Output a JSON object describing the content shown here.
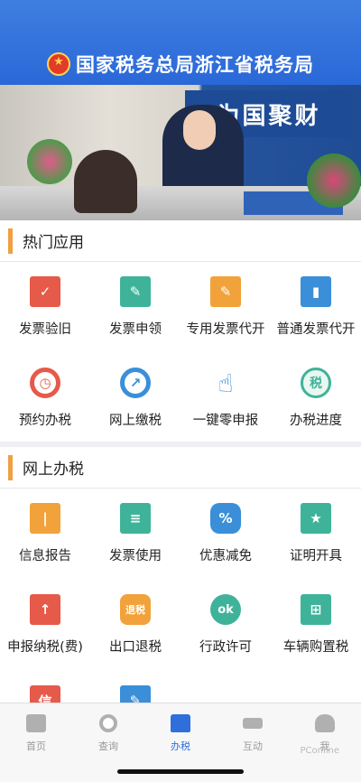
{
  "header": {
    "title": "国家税务总局浙江省税务局",
    "emblem_icon": "tax-emblem-icon"
  },
  "banner": {
    "sign_text": "为国聚财"
  },
  "hot_apps": {
    "title": "热门应用",
    "items": [
      {
        "label": "发票验旧",
        "icon": "invoice-check-icon",
        "glyph": "✓"
      },
      {
        "label": "发票申领",
        "icon": "pen-icon",
        "glyph": "✎"
      },
      {
        "label": "专用发票代开",
        "icon": "edit-icon",
        "glyph": "✎"
      },
      {
        "label": "普通发票代开",
        "icon": "document-icon",
        "glyph": "▮"
      },
      {
        "label": "预约办税",
        "icon": "clock-icon",
        "glyph": "◷"
      },
      {
        "label": "网上缴税",
        "icon": "compass-icon",
        "glyph": "↗"
      },
      {
        "label": "一键零申报",
        "icon": "tap-hand-icon",
        "glyph": "☝"
      },
      {
        "label": "办税进度",
        "icon": "tax-progress-icon",
        "glyph": "税"
      }
    ]
  },
  "online_tax": {
    "title": "网上办税",
    "items": [
      {
        "label": "信息报告",
        "icon": "info-report-icon",
        "glyph": "|"
      },
      {
        "label": "发票使用",
        "icon": "invoice-use-icon",
        "glyph": "≡"
      },
      {
        "label": "优惠减免",
        "icon": "discount-ticket-icon",
        "glyph": "%"
      },
      {
        "label": "证明开具",
        "icon": "certificate-icon",
        "glyph": "★"
      },
      {
        "label": "申报纳税(费)",
        "icon": "declare-icon",
        "glyph": "↑"
      },
      {
        "label": "出口退税",
        "icon": "tax-refund-icon",
        "glyph": "退税"
      },
      {
        "label": "行政许可",
        "icon": "ok-icon",
        "glyph": "ok"
      },
      {
        "label": "车辆购置税",
        "icon": "vehicle-tax-icon",
        "glyph": "⊞"
      },
      {
        "label": "",
        "icon": "credit-icon",
        "glyph": "信"
      },
      {
        "label": "",
        "icon": "form-edit-icon",
        "glyph": "✎"
      }
    ]
  },
  "tabbar": {
    "items": [
      {
        "label": "首页",
        "icon": "home-monitor-icon",
        "active": false
      },
      {
        "label": "查询",
        "icon": "search-icon",
        "active": false
      },
      {
        "label": "办税",
        "icon": "home-icon",
        "active": true
      },
      {
        "label": "互动",
        "icon": "interact-icon",
        "active": false
      },
      {
        "label": "我",
        "icon": "user-icon",
        "active": false
      }
    ]
  },
  "watermark": "PConline",
  "colors": {
    "header": "#2a68d8",
    "accent": "#f0a040",
    "active_tab": "#2f6fdb"
  }
}
